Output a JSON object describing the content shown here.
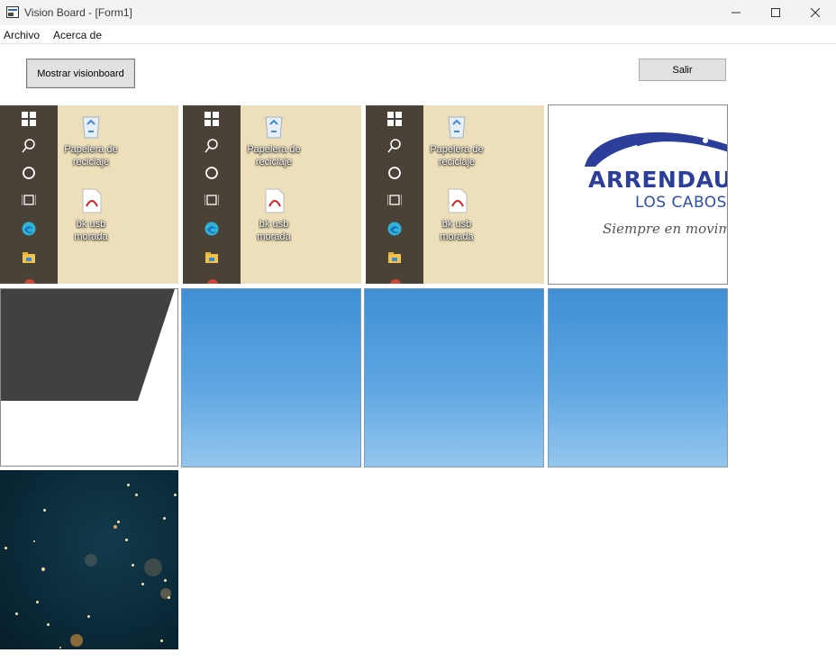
{
  "window": {
    "title": "Vision Board - [Form1]"
  },
  "menu": {
    "items": [
      "Archivo",
      "Acerca de"
    ]
  },
  "buttons": {
    "mostrar": "Mostrar visionboard",
    "salir": "Salir"
  },
  "desktop_icons": {
    "recycle": "Papelera de reciclaje",
    "pdf": "bk usb morada"
  },
  "logo": {
    "brand": "ARRENDAU",
    "sub": "LOS CABOS",
    "slogan": "Siempre en movimi"
  },
  "colors": {
    "titlebar": "#f3f3f3",
    "accent_blue": "#2b3f9a",
    "sky": "#4a98dc"
  }
}
